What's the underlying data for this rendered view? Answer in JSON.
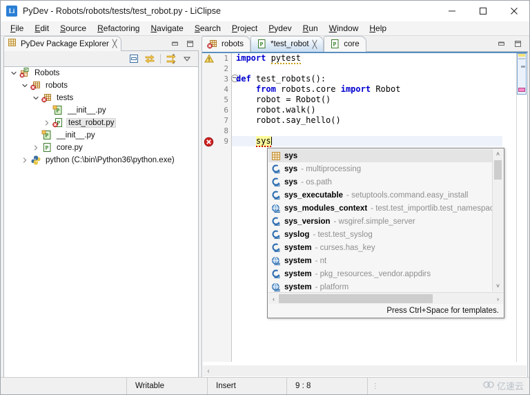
{
  "window": {
    "title": "PyDev - Robots/robots/tests/test_robot.py - LiClipse",
    "app_icon_label": "Li",
    "minimize_label": "Minimize",
    "maximize_label": "Maximize",
    "close_label": "Close"
  },
  "menubar": {
    "items": [
      {
        "label": "File"
      },
      {
        "label": "Edit"
      },
      {
        "label": "Source"
      },
      {
        "label": "Refactoring"
      },
      {
        "label": "Navigate"
      },
      {
        "label": "Search"
      },
      {
        "label": "Project"
      },
      {
        "label": "Pydev"
      },
      {
        "label": "Run"
      },
      {
        "label": "Window"
      },
      {
        "label": "Help"
      }
    ]
  },
  "package_explorer": {
    "tab_label": "PyDev Package Explorer",
    "close_glyph": "╳",
    "toolbar": [
      {
        "name": "collapse-all-icon"
      },
      {
        "name": "link-with-editor-icon"
      },
      {
        "name": "sort-filter-icon"
      },
      {
        "name": "view-menu-icon"
      }
    ],
    "tree": [
      {
        "indent": 0,
        "twisty": "open",
        "icon": "project-icon",
        "label": "Robots",
        "selected": false
      },
      {
        "indent": 1,
        "twisty": "open",
        "icon": "package-icon",
        "label": "robots",
        "selected": false
      },
      {
        "indent": 2,
        "twisty": "open",
        "icon": "package-icon",
        "label": "tests",
        "selected": false
      },
      {
        "indent": 3,
        "twisty": "none",
        "icon": "initpy-icon",
        "label": "__init__.py",
        "selected": false
      },
      {
        "indent": 3,
        "twisty": "closed",
        "icon": "pyerror-icon",
        "label": "test_robot.py",
        "selected": true
      },
      {
        "indent": 2,
        "twisty": "none",
        "icon": "initpy-icon",
        "label": "__init__.py",
        "selected": false
      },
      {
        "indent": 2,
        "twisty": "closed",
        "icon": "py-icon",
        "label": "core.py",
        "selected": false
      },
      {
        "indent": 1,
        "twisty": "closed",
        "icon": "python-icon",
        "label": "python  (C:\\bin\\Python36\\python.exe)",
        "selected": false
      }
    ]
  },
  "editor": {
    "tabs": [
      {
        "label": "robots",
        "icon": "package-icon",
        "active": false,
        "dirty": false,
        "closable": false
      },
      {
        "label": "*test_robot",
        "icon": "py-icon",
        "active": true,
        "dirty": true,
        "closable": true
      },
      {
        "label": "core",
        "icon": "py-icon",
        "active": false,
        "dirty": false,
        "closable": false
      }
    ],
    "close_glyph": "╳",
    "minimize_label": "Minimize",
    "maximize_label": "Maximize",
    "line_numbers": [
      "1",
      "2",
      "3",
      "4",
      "5",
      "6",
      "7",
      "8",
      "9"
    ],
    "code_lines": [
      {
        "n": "1",
        "tokens": [
          {
            "t": "import ",
            "c": "kw"
          },
          {
            "t": "pytest",
            "c": "warn"
          }
        ]
      },
      {
        "n": "2",
        "tokens": []
      },
      {
        "n": "3",
        "tokens": [
          {
            "t": "def ",
            "c": "kw"
          },
          {
            "t": "test_robots():",
            "c": "plain"
          }
        ]
      },
      {
        "n": "4",
        "tokens": [
          {
            "t": "    ",
            "c": "plain"
          },
          {
            "t": "from ",
            "c": "kw"
          },
          {
            "t": "robots.core ",
            "c": "plain"
          },
          {
            "t": "import ",
            "c": "kw"
          },
          {
            "t": "Robot",
            "c": "plain"
          }
        ]
      },
      {
        "n": "5",
        "tokens": [
          {
            "t": "    robot = Robot()",
            "c": "plain"
          }
        ]
      },
      {
        "n": "6",
        "tokens": [
          {
            "t": "    robot.walk()",
            "c": "plain"
          }
        ]
      },
      {
        "n": "7",
        "tokens": [
          {
            "t": "    robot.say_hello()",
            "c": "plain"
          }
        ]
      },
      {
        "n": "8",
        "tokens": []
      },
      {
        "n": "9",
        "tokens": [
          {
            "t": "    ",
            "c": "plain"
          },
          {
            "t": "sys",
            "c": "err"
          }
        ]
      }
    ],
    "markers": [
      {
        "line": 1,
        "type": "warning-icon"
      },
      {
        "line": 9,
        "type": "error-icon"
      }
    ],
    "fold_line": 3,
    "horizontal_scroll_left_glyph": "‹"
  },
  "autocomplete": {
    "items": [
      {
        "icon": "template-icon",
        "name": "sys",
        "context": "",
        "selected": true
      },
      {
        "icon": "import-icon",
        "name": "sys",
        "context": " - multiprocessing",
        "selected": false
      },
      {
        "icon": "import-icon",
        "name": "sys",
        "context": " - os.path",
        "selected": false
      },
      {
        "icon": "import-icon",
        "name": "sys_executable",
        "context": " - setuptools.command.easy_install",
        "selected": false
      },
      {
        "icon": "module-icon",
        "name": "sys_modules_context",
        "context": " - test.test_importlib.test_namespace",
        "selected": false
      },
      {
        "icon": "import-icon",
        "name": "sys_version",
        "context": " - wsgiref.simple_server",
        "selected": false
      },
      {
        "icon": "import-icon",
        "name": "syslog",
        "context": " - test.test_syslog",
        "selected": false
      },
      {
        "icon": "import-icon",
        "name": "system",
        "context": " - curses.has_key",
        "selected": false
      },
      {
        "icon": "module-icon",
        "name": "system",
        "context": " - nt",
        "selected": false
      },
      {
        "icon": "import-icon",
        "name": "system",
        "context": " - pkg_resources._vendor.appdirs",
        "selected": false
      },
      {
        "icon": "module-icon",
        "name": "system",
        "context": " - platform",
        "selected": false
      }
    ],
    "footer": "Press Ctrl+Space for templates.",
    "scroll_up_glyph": "˄",
    "scroll_down_glyph": "˅",
    "scroll_left_glyph": "‹",
    "scroll_right_glyph": "›"
  },
  "statusbar": {
    "writable": "Writable",
    "insert": "Insert",
    "position": "9 : 8",
    "dots": "⋮"
  },
  "watermark": {
    "text": "亿速云"
  },
  "colors": {
    "accent": "#2a7fd4",
    "keyword": "#0000d0",
    "error": "#d00000",
    "warning": "#c8a000",
    "selection": "#e8e8e8",
    "tab_active_bg": "#c9ddf0"
  }
}
